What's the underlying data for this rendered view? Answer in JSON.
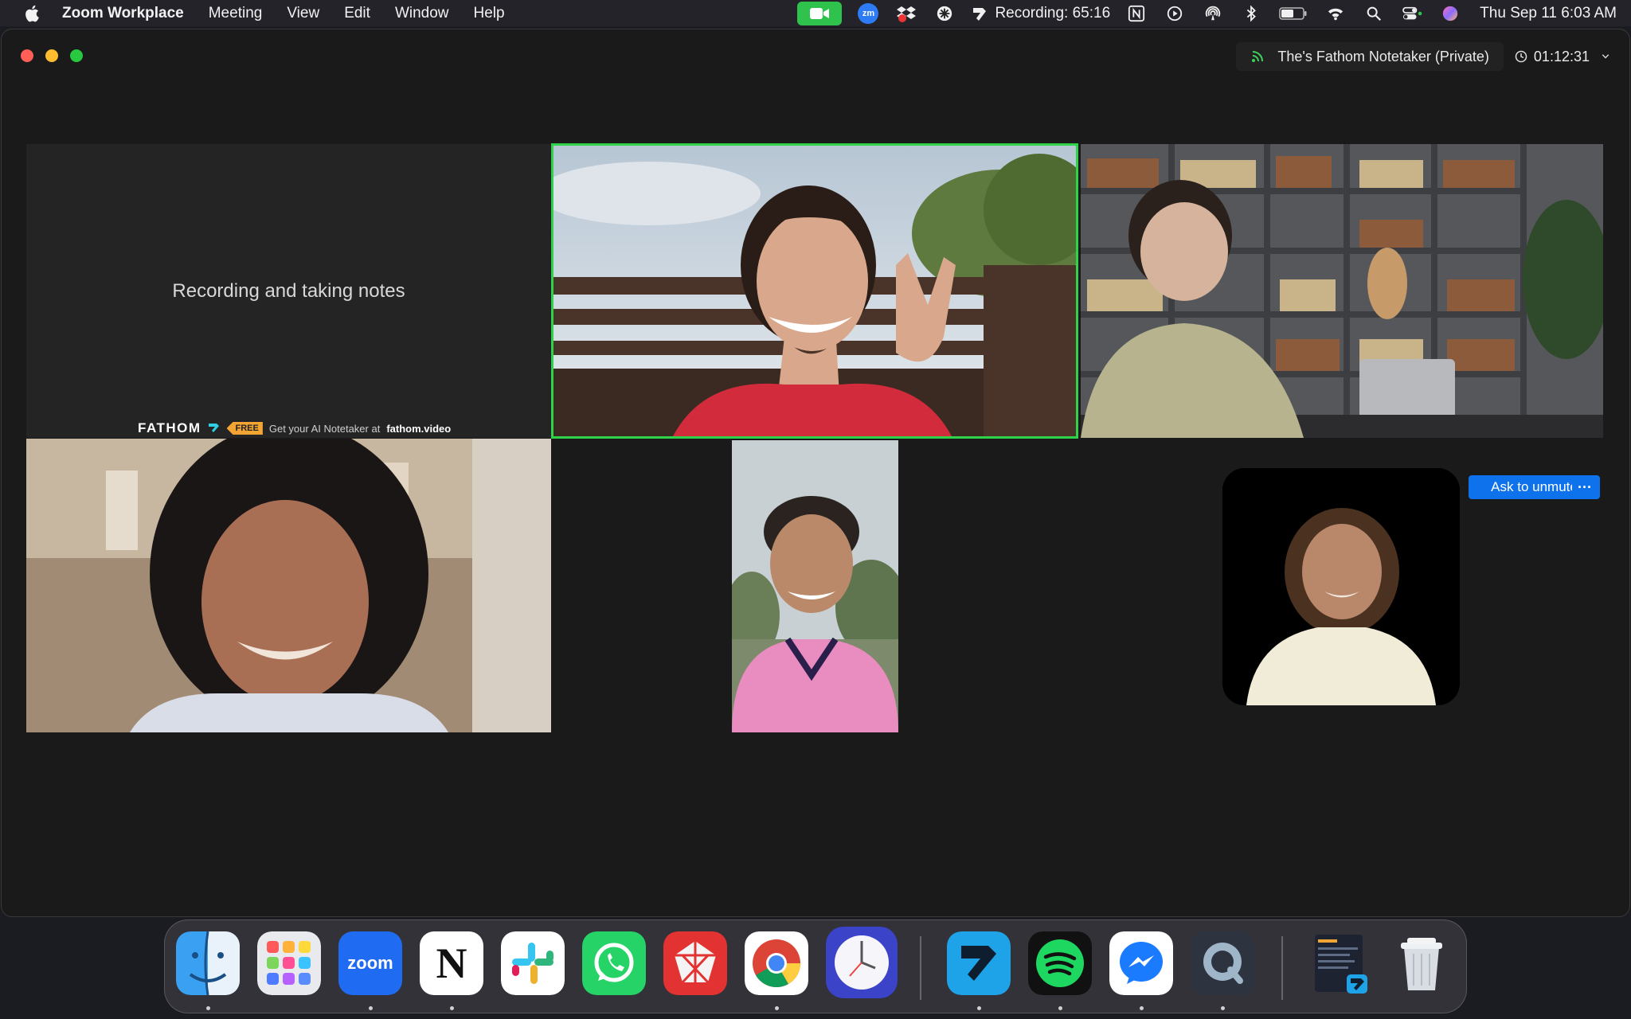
{
  "menubar": {
    "app_name": "Zoom Workplace",
    "menus": [
      "Meeting",
      "View",
      "Edit",
      "Window",
      "Help"
    ],
    "zoom_badge": "zm",
    "recording_status": "Recording: 65:16",
    "datetime": "Thu Sep 11  6:03 AM",
    "status_icons": [
      "zoom-camera-icon",
      "zoom-status-icon",
      "dropbox-icon",
      "perplexity-icon",
      "recording-icon",
      "notion-icon",
      "play-icon",
      "airdrop-icon",
      "bluetooth-icon",
      "battery-icon",
      "wifi-icon",
      "search-icon",
      "control-center-icon",
      "siri-icon"
    ]
  },
  "window": {
    "notetaker_label": "The's Fathom Notetaker (Private)",
    "meeting_timer": "01:12:31"
  },
  "tiles": {
    "fathom": {
      "title": "Recording and taking notes",
      "brand": "FATHOM",
      "badge": "FREE",
      "tagline": "Get your AI Notetaker at",
      "link": "fathom.video"
    },
    "participants": [
      {
        "id": "active-speaker",
        "highlighted": true
      },
      {
        "id": "library-participant"
      },
      {
        "id": "curly-hair-participant"
      },
      {
        "id": "pink-jersey-participant"
      },
      {
        "id": "avatar-participant"
      }
    ],
    "ask_to_unmute": "Ask to unmute",
    "more": "···"
  },
  "dock": {
    "apps": [
      "Finder",
      "Launchpad",
      "Zoom",
      "Notion",
      "Slack",
      "WhatsApp",
      "RubyMine",
      "Chrome",
      "Time Out",
      "Fathom",
      "Spotify",
      "Messenger",
      "QuickTime",
      "Recent Window",
      "Trash"
    ],
    "zoom_tile_label": "zoom",
    "notion_tile_label": "N"
  },
  "colors": {
    "active_speaker_border": "#2fd34a",
    "unmute_button": "#0e72ed",
    "fathom_badge": "#f3a533"
  }
}
